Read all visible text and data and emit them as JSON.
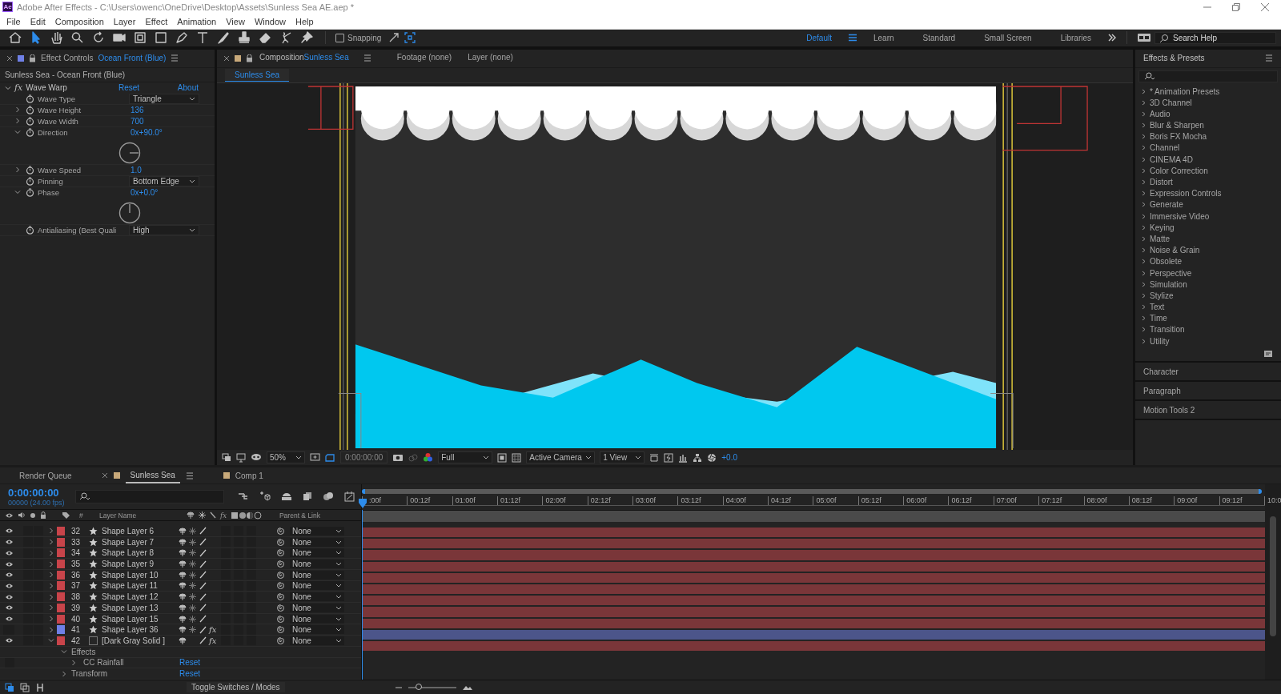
{
  "window": {
    "logo": "Ae",
    "title": "Adobe After Effects - C:\\Users\\owenc\\OneDrive\\Desktop\\Assets\\Sunless Sea AE.aep *"
  },
  "menu": [
    "File",
    "Edit",
    "Composition",
    "Layer",
    "Effect",
    "Animation",
    "View",
    "Window",
    "Help"
  ],
  "toolbar": {
    "snapping": {
      "label": "Snapping",
      "checked": false
    },
    "workspaces": [
      {
        "label": "Default",
        "selected": true
      },
      {
        "label": "Learn",
        "selected": false
      },
      {
        "label": "Standard",
        "selected": false
      },
      {
        "label": "Small Screen",
        "selected": false
      },
      {
        "label": "Libraries",
        "selected": false
      }
    ],
    "search_help": {
      "placeholder": "Search Help"
    }
  },
  "effect_controls": {
    "title": "Effect Controls",
    "layer": "Ocean Front (Blue)",
    "breadcrumb": "Sunless Sea - Ocean Front (Blue)",
    "effect": {
      "badge": "fx",
      "name": "Wave Warp",
      "expanded": true,
      "reset": "Reset",
      "about": "About"
    },
    "properties": [
      {
        "kind": "dropdown",
        "name": "Wave Type",
        "value": "Triangle"
      },
      {
        "kind": "number",
        "name": "Wave Height",
        "value": "136",
        "expanded": false
      },
      {
        "kind": "number",
        "name": "Wave Width",
        "value": "700",
        "expanded": false
      },
      {
        "kind": "angle",
        "name": "Direction",
        "value": "0x+90.0°",
        "expanded": true
      },
      {
        "kind": "number",
        "name": "Wave Speed",
        "value": "1.0",
        "expanded": false
      },
      {
        "kind": "dropdown",
        "name": "Pinning",
        "value": "Bottom Edge"
      },
      {
        "kind": "angle",
        "name": "Phase",
        "value": "0x+0.0°",
        "expanded": true
      },
      {
        "kind": "dropdown",
        "name": "Antialiasing (Best Quali",
        "value": "High"
      }
    ]
  },
  "composition": {
    "tabs": [
      {
        "prefix": "Composition",
        "label": "Sunless Sea",
        "selected": true
      },
      {
        "label": "Footage (none)",
        "selected": false
      },
      {
        "label": "Layer (none)",
        "selected": false
      }
    ],
    "breadcrumb": "Sunless Sea",
    "viewer_bar": {
      "zoom": "50%",
      "timecode": "0:00:00:00",
      "resolution": "Full",
      "camera": "Active Camera",
      "views": "1 View",
      "exposure": "+0.0"
    }
  },
  "effects_presets": {
    "title": "Effects & Presets",
    "categories": [
      "* Animation Presets",
      "3D Channel",
      "Audio",
      "Blur & Sharpen",
      "Boris FX Mocha",
      "Channel",
      "CINEMA 4D",
      "Color Correction",
      "Distort",
      "Expression Controls",
      "Generate",
      "Immersive Video",
      "Keying",
      "Matte",
      "Noise & Grain",
      "Obsolete",
      "Perspective",
      "Simulation",
      "Stylize",
      "Text",
      "Time",
      "Transition",
      "Utility"
    ]
  },
  "panels": [
    "Character",
    "Paragraph",
    "Motion Tools 2"
  ],
  "timeline": {
    "tabs": [
      {
        "label": "Render Queue",
        "selected": false,
        "kind": "queue"
      },
      {
        "label": "Sunless Sea",
        "selected": true,
        "kind": "comp"
      },
      {
        "label": "Comp 1",
        "selected": false,
        "kind": "comp"
      }
    ],
    "timecode": "0:00:00:00",
    "frame_info": "00000 (24.00 fps)",
    "columns": {
      "number": "#",
      "layer_name": "Layer Name",
      "fx": "fx",
      "parent": "Parent & Link"
    },
    "ruler": [
      ":00f",
      "00:12f",
      "01:00f",
      "01:12f",
      "02:00f",
      "02:12f",
      "03:00f",
      "03:12f",
      "04:00f",
      "04:12f",
      "05:00f",
      "05:12f",
      "06:00f",
      "06:12f",
      "07:00f",
      "07:12f",
      "08:00f",
      "08:12f",
      "09:00f",
      "09:12f",
      "10:0"
    ],
    "layers": [
      {
        "number": "32",
        "name": "Shape Layer 6",
        "kind": "shape",
        "color": "#c8444a",
        "visible": true,
        "expanded": false,
        "parent": "None"
      },
      {
        "number": "33",
        "name": "Shape Layer 7",
        "kind": "shape",
        "color": "#c8444a",
        "visible": true,
        "expanded": false,
        "parent": "None"
      },
      {
        "number": "34",
        "name": "Shape Layer 8",
        "kind": "shape",
        "color": "#c8444a",
        "visible": true,
        "expanded": false,
        "parent": "None"
      },
      {
        "number": "35",
        "name": "Shape Layer 9",
        "kind": "shape",
        "color": "#c8444a",
        "visible": true,
        "expanded": false,
        "parent": "None"
      },
      {
        "number": "36",
        "name": "Shape Layer 10",
        "kind": "shape",
        "color": "#c8444a",
        "visible": true,
        "expanded": false,
        "parent": "None"
      },
      {
        "number": "37",
        "name": "Shape Layer 11",
        "kind": "shape",
        "color": "#c8444a",
        "visible": true,
        "expanded": false,
        "parent": "None"
      },
      {
        "number": "38",
        "name": "Shape Layer 12",
        "kind": "shape",
        "color": "#c8444a",
        "visible": true,
        "expanded": false,
        "parent": "None"
      },
      {
        "number": "39",
        "name": "Shape Layer 13",
        "kind": "shape",
        "color": "#c8444a",
        "visible": true,
        "expanded": false,
        "parent": "None"
      },
      {
        "number": "40",
        "name": "Shape Layer 15",
        "kind": "shape",
        "color": "#c8444a",
        "visible": true,
        "expanded": false,
        "parent": "None"
      },
      {
        "number": "41",
        "name": "Shape Layer 36",
        "kind": "shape",
        "color": "#6f80e6",
        "visible": false,
        "expanded": false,
        "fx": {
          "label": "fx",
          "on": true
        },
        "parent": "None"
      },
      {
        "number": "42",
        "name": "[Dark Gray Solid ]",
        "kind": "solid",
        "color": "#c8444a",
        "visible": true,
        "expanded": true,
        "fx": {
          "label": "fx",
          "on": true
        },
        "parent": "None",
        "children": [
          {
            "name": "Effects",
            "expanded": true,
            "children": [
              {
                "name": "CC Rainfall",
                "expanded": false,
                "reset": "Reset"
              }
            ]
          },
          {
            "name": "Transform",
            "expanded": false,
            "reset": "Reset"
          }
        ]
      }
    ],
    "toggle": "Toggle Switches / Modes",
    "zoom": {
      "level": 0.15
    }
  }
}
